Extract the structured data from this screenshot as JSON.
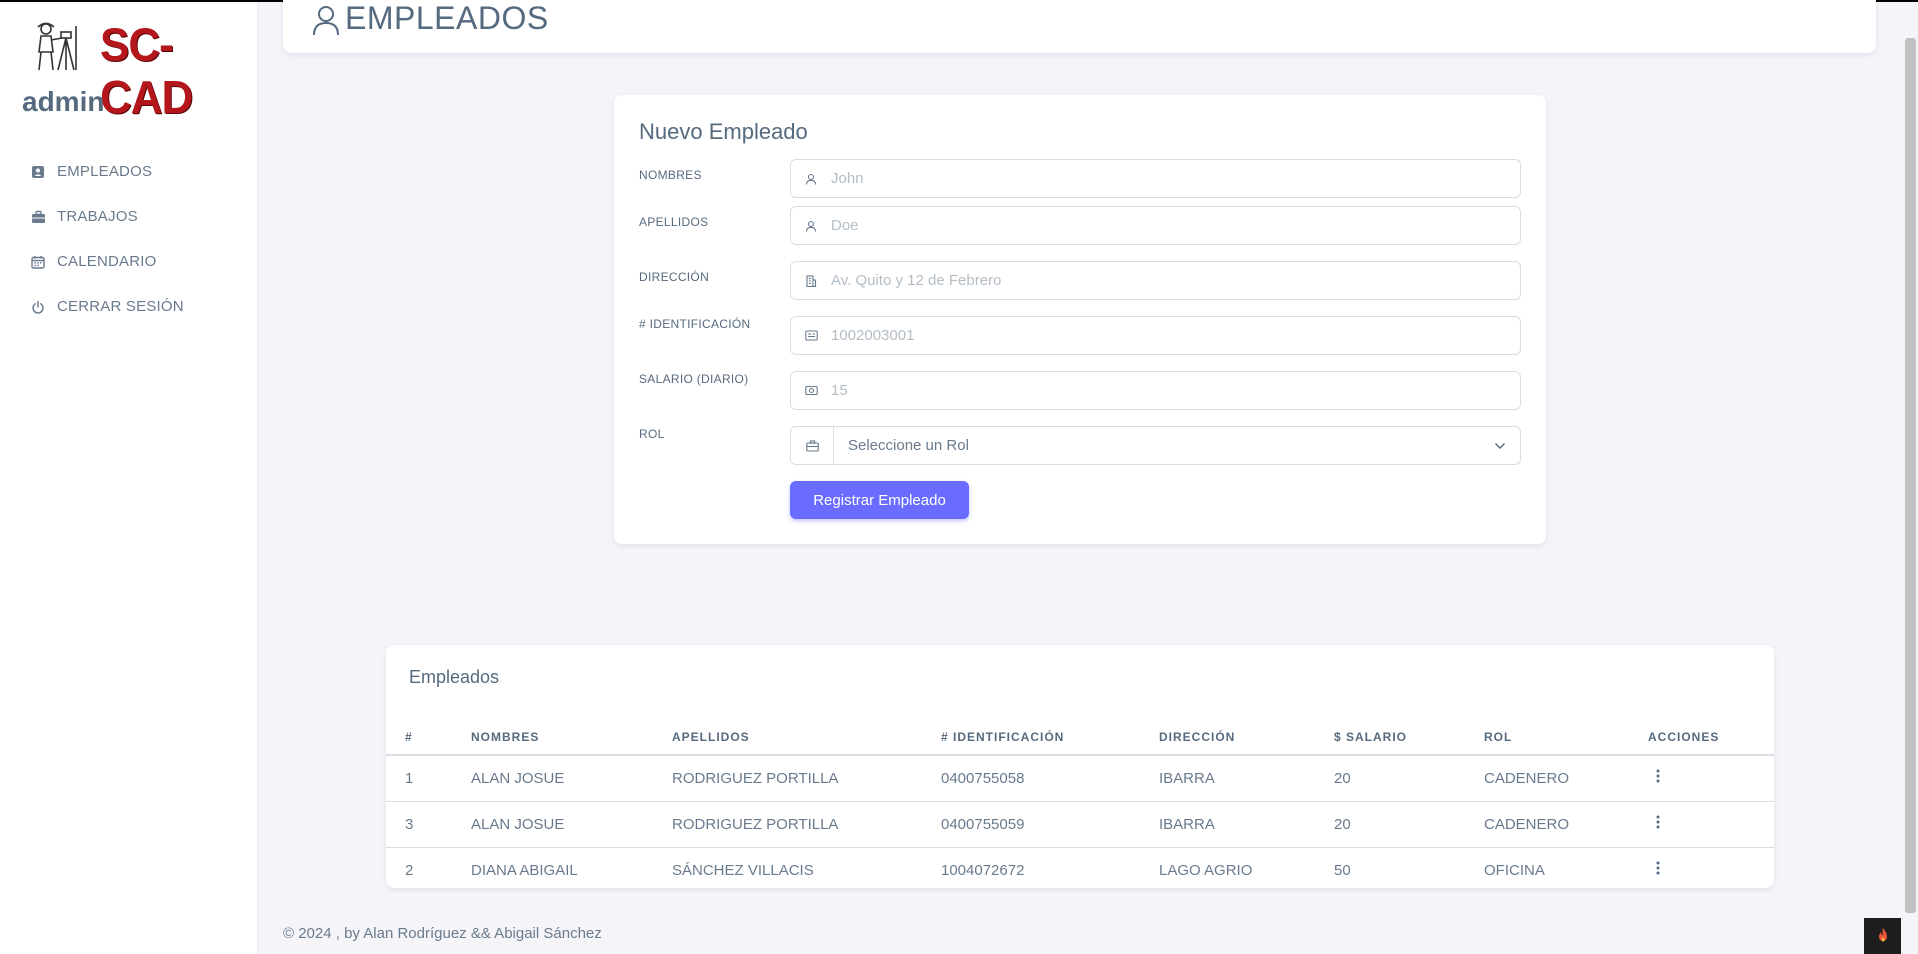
{
  "sidebar": {
    "logo_text": "SC-CAD",
    "user": "admin",
    "items": [
      {
        "label": "EMPLEADOS",
        "icon": "badge-icon"
      },
      {
        "label": "TRABAJOS",
        "icon": "briefcase-icon"
      },
      {
        "label": "CALENDARIO",
        "icon": "calendar-icon"
      },
      {
        "label": "CERRAR SESIÓN",
        "icon": "power-icon"
      }
    ]
  },
  "header": {
    "title": "EMPLEADOS",
    "icon": "user-icon"
  },
  "form": {
    "title": "Nuevo Empleado",
    "fields": [
      {
        "label": "NOMBRES",
        "placeholder": "John",
        "icon": "user-icon"
      },
      {
        "label": "APELLIDOS",
        "placeholder": "Doe",
        "icon": "user-icon"
      },
      {
        "label": "DIRECCIÓN",
        "placeholder": "Av. Quito y 12 de Febrero",
        "icon": "building-icon"
      },
      {
        "label": "# IDENTIFICACIÓN",
        "placeholder": "1002003001",
        "icon": "id-card-icon"
      },
      {
        "label": "SALARIO (DIARIO)",
        "placeholder": "15",
        "icon": "money-icon"
      }
    ],
    "rol": {
      "label": "ROL",
      "selected": "Seleccione un Rol",
      "icon": "briefcase-icon"
    },
    "submit_label": "Registrar Empleado"
  },
  "table": {
    "title": "Empleados",
    "headers": [
      "#",
      "NOMBRES",
      "APELLIDOS",
      "# IDENTIFICACIÓN",
      "DIRECCIÓN",
      "$ SALARIO",
      "ROL",
      "ACCIONES"
    ],
    "rows": [
      [
        "1",
        "ALAN JOSUE",
        "RODRIGUEZ PORTILLA",
        "0400755058",
        "IBARRA",
        "20",
        "CADENERO"
      ],
      [
        "3",
        "ALAN JOSUE",
        "RODRIGUEZ PORTILLA",
        "0400755059",
        "IBARRA",
        "20",
        "CADENERO"
      ],
      [
        "2",
        "DIANA ABIGAIL",
        "SÁNCHEZ VILLACIS",
        "1004072672",
        "LAGO AGRIO",
        "50",
        "OFICINA"
      ]
    ]
  },
  "footer": {
    "text": "© 2024 , by Alan Rodríguez && Abigail Sánchez"
  },
  "colors": {
    "primary": "#696cff",
    "text": "#566a7f",
    "logo_red": "#b3161b"
  }
}
